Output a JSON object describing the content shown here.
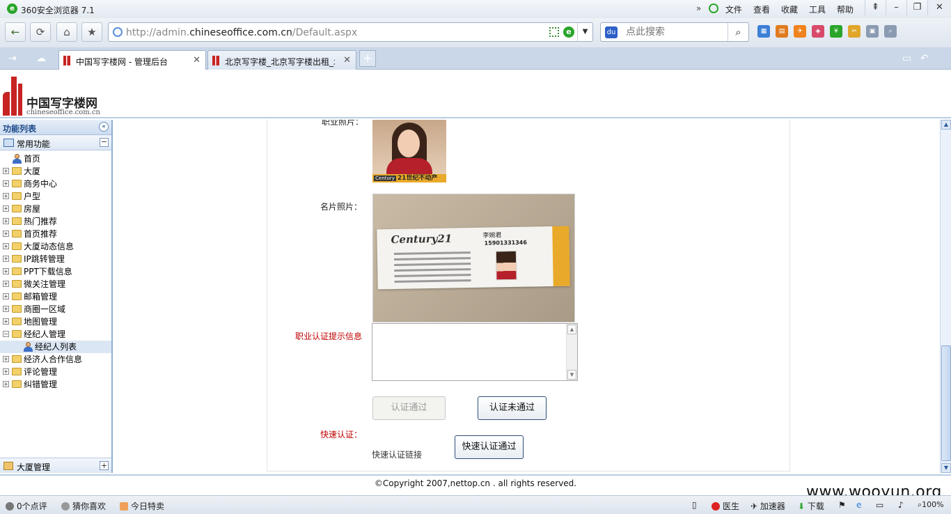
{
  "browser": {
    "title": "360安全浏览器 7.1",
    "menu": [
      "文件",
      "查看",
      "收藏",
      "工具",
      "帮助"
    ],
    "url_prefix": "http://admin.",
    "url_domain": "chineseoffice.com.cn",
    "url_path": "/Default.aspx",
    "search_placeholder": "点此搜索",
    "tabs": [
      {
        "label": "中国写字楼网 - 管理后台",
        "active": true
      },
      {
        "label": "北京写字楼_北京写字楼出租_北",
        "active": false
      }
    ]
  },
  "site": {
    "name": "中国写字楼网",
    "domain": "chineseoffice.com.cn"
  },
  "sidebar": {
    "header": "功能列表",
    "group": "常用功能",
    "items": [
      {
        "label": "首页",
        "type": "page"
      },
      {
        "label": "大厦",
        "type": "folder"
      },
      {
        "label": "商务中心",
        "type": "folder"
      },
      {
        "label": "户型",
        "type": "folder"
      },
      {
        "label": "房屋",
        "type": "folder"
      },
      {
        "label": "热门推荐",
        "type": "folder"
      },
      {
        "label": "首页推荐",
        "type": "folder"
      },
      {
        "label": "大厦动态信息",
        "type": "folder"
      },
      {
        "label": "IP跳转管理",
        "type": "folder"
      },
      {
        "label": "PPT下载信息",
        "type": "folder"
      },
      {
        "label": "微关注管理",
        "type": "folder"
      },
      {
        "label": "邮箱管理",
        "type": "folder"
      },
      {
        "label": "商圈一区域",
        "type": "folder"
      },
      {
        "label": "地图管理",
        "type": "folder"
      },
      {
        "label": "经纪人管理",
        "type": "open-folder"
      },
      {
        "label": "经纪人列表",
        "type": "child-selected"
      },
      {
        "label": "经济人合作信息",
        "type": "folder"
      },
      {
        "label": "评论管理",
        "type": "folder"
      },
      {
        "label": "纠错管理",
        "type": "folder"
      }
    ],
    "footer_group": "大厦管理"
  },
  "form": {
    "pro_photo_label": "职业照片：",
    "photo_band_text": "21世纪不动产",
    "photo_band_logo": "Century",
    "card_photo_label": "名片照片：",
    "card_brand": "Century21",
    "card_name": "李婉君",
    "card_phone": "15901331346",
    "cert_info_label": "职业认证提示信息",
    "cert_info_value": "",
    "approve_button": "认证通过",
    "reject_button": "认证未通过",
    "quick_label": "快速认证：",
    "quick_link_label": "快速认证链接",
    "quick_button": "快速认证通过"
  },
  "footer": {
    "copyright": "©Copyright 2007,nettop.cn . all rights reserved."
  },
  "statusbar": {
    "left": [
      "0个点评",
      "猜你喜欢",
      "今日特卖"
    ],
    "right": [
      "医生",
      "加速器",
      "下载"
    ],
    "zoom": "100%"
  },
  "watermark": "www.wooyun.org"
}
